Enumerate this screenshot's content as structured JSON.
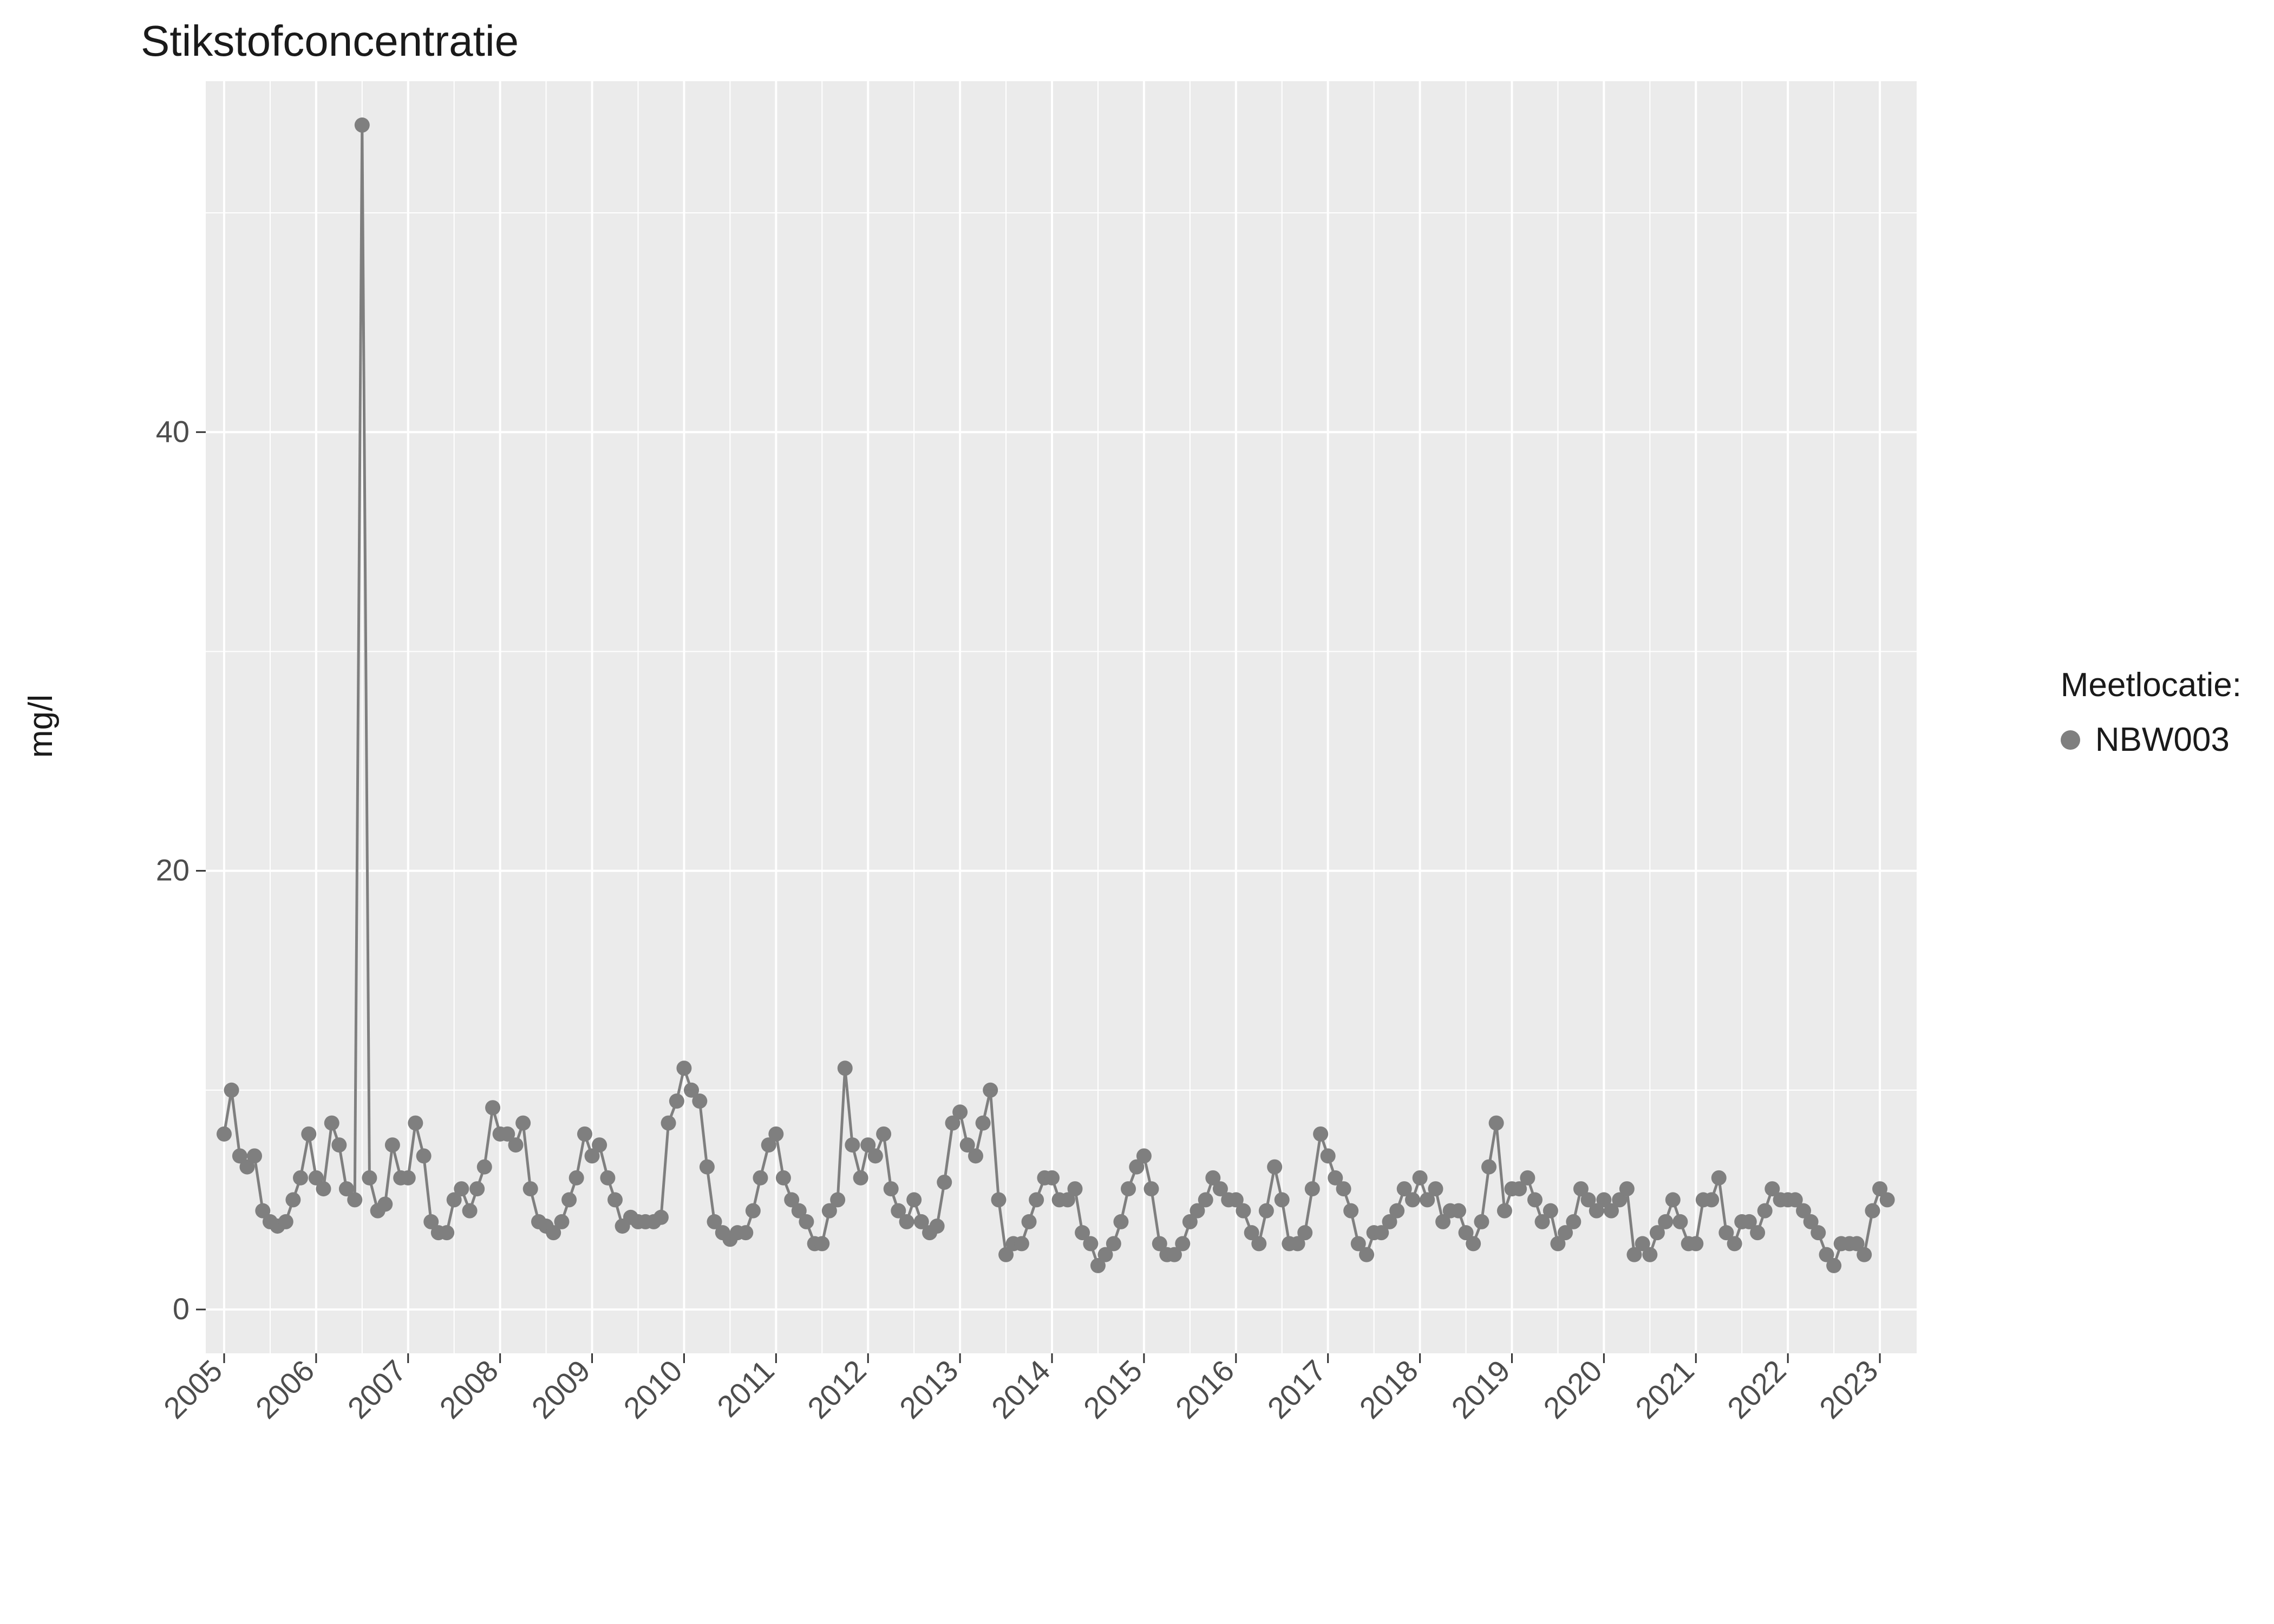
{
  "chart_data": {
    "type": "line",
    "title": "Stikstofconcentratie",
    "ylabel": "mg/l",
    "xlabel": "",
    "x_ticks": [
      "2005",
      "2006",
      "2007",
      "2008",
      "2009",
      "2010",
      "2011",
      "2012",
      "2013",
      "2014",
      "2015",
      "2016",
      "2017",
      "2018",
      "2019",
      "2020",
      "2021",
      "2022",
      "2023"
    ],
    "y_ticks": [
      0,
      20,
      40
    ],
    "ylim": [
      -2,
      56
    ],
    "xlim": [
      2004.8,
      2023.4
    ],
    "legend_title": "Meetlocatie:",
    "series": [
      {
        "name": "NBW003",
        "color": "#7f7f7f",
        "x": [
          2005.0,
          2005.08,
          2005.17,
          2005.25,
          2005.33,
          2005.42,
          2005.5,
          2005.58,
          2005.67,
          2005.75,
          2005.83,
          2005.92,
          2006.0,
          2006.08,
          2006.17,
          2006.25,
          2006.33,
          2006.42,
          2006.5,
          2006.58,
          2006.67,
          2006.75,
          2006.83,
          2006.92,
          2007.0,
          2007.08,
          2007.17,
          2007.25,
          2007.33,
          2007.42,
          2007.5,
          2007.58,
          2007.67,
          2007.75,
          2007.83,
          2007.92,
          2008.0,
          2008.08,
          2008.17,
          2008.25,
          2008.33,
          2008.42,
          2008.5,
          2008.58,
          2008.67,
          2008.75,
          2008.83,
          2008.92,
          2009.0,
          2009.08,
          2009.17,
          2009.25,
          2009.33,
          2009.42,
          2009.5,
          2009.58,
          2009.67,
          2009.75,
          2009.83,
          2009.92,
          2010.0,
          2010.08,
          2010.17,
          2010.25,
          2010.33,
          2010.42,
          2010.5,
          2010.58,
          2010.67,
          2010.75,
          2010.83,
          2010.92,
          2011.0,
          2011.08,
          2011.17,
          2011.25,
          2011.33,
          2011.42,
          2011.5,
          2011.58,
          2011.67,
          2011.75,
          2011.83,
          2011.92,
          2012.0,
          2012.08,
          2012.17,
          2012.25,
          2012.33,
          2012.42,
          2012.5,
          2012.58,
          2012.67,
          2012.75,
          2012.83,
          2012.92,
          2013.0,
          2013.08,
          2013.17,
          2013.25,
          2013.33,
          2013.42,
          2013.5,
          2013.58,
          2013.67,
          2013.75,
          2013.83,
          2013.92,
          2014.0,
          2014.08,
          2014.17,
          2014.25,
          2014.33,
          2014.42,
          2014.5,
          2014.58,
          2014.67,
          2014.75,
          2014.83,
          2014.92,
          2015.0,
          2015.08,
          2015.17,
          2015.25,
          2015.33,
          2015.42,
          2015.5,
          2015.58,
          2015.67,
          2015.75,
          2015.83,
          2015.92,
          2016.0,
          2016.08,
          2016.17,
          2016.25,
          2016.33,
          2016.42,
          2016.5,
          2016.58,
          2016.67,
          2016.75,
          2016.83,
          2016.92,
          2017.0,
          2017.08,
          2017.17,
          2017.25,
          2017.33,
          2017.42,
          2017.5,
          2017.58,
          2017.67,
          2017.75,
          2017.83,
          2017.92,
          2018.0,
          2018.08,
          2018.17,
          2018.25,
          2018.33,
          2018.42,
          2018.5,
          2018.58,
          2018.67,
          2018.75,
          2018.83,
          2018.92,
          2019.0,
          2019.08,
          2019.17,
          2019.25,
          2019.33,
          2019.42,
          2019.5,
          2019.58,
          2019.67,
          2019.75,
          2019.83,
          2019.92,
          2020.0,
          2020.08,
          2020.17,
          2020.25,
          2020.33,
          2020.42,
          2020.5,
          2020.58,
          2020.67,
          2020.75,
          2020.83,
          2020.92,
          2021.0,
          2021.08,
          2021.17,
          2021.25,
          2021.33,
          2021.42,
          2021.5,
          2021.58,
          2021.67,
          2021.75,
          2021.83,
          2021.92,
          2022.0,
          2022.08,
          2022.17,
          2022.25,
          2022.33,
          2022.42,
          2022.5,
          2022.58,
          2022.67,
          2022.75,
          2022.83,
          2022.92,
          2023.0,
          2023.08
        ],
        "values": [
          8.0,
          10.0,
          7.0,
          6.5,
          7.0,
          4.5,
          4.0,
          3.8,
          4.0,
          5.0,
          6.0,
          8.0,
          6.0,
          5.5,
          8.5,
          7.5,
          5.5,
          5.0,
          54.0,
          6.0,
          4.5,
          4.8,
          7.5,
          6.0,
          6.0,
          8.5,
          7.0,
          4.0,
          3.5,
          3.5,
          5.0,
          5.5,
          4.5,
          5.5,
          6.5,
          9.2,
          8.0,
          8.0,
          7.5,
          8.5,
          5.5,
          4.0,
          3.8,
          3.5,
          4.0,
          5.0,
          6.0,
          8.0,
          7.0,
          7.5,
          6.0,
          5.0,
          3.8,
          4.2,
          4.0,
          4.0,
          4.0,
          4.2,
          8.5,
          9.5,
          11.0,
          10.0,
          9.5,
          6.5,
          4.0,
          3.5,
          3.2,
          3.5,
          3.5,
          4.5,
          6.0,
          7.5,
          8.0,
          6.0,
          5.0,
          4.5,
          4.0,
          3.0,
          3.0,
          4.5,
          5.0,
          11.0,
          7.5,
          6.0,
          7.5,
          7.0,
          8.0,
          5.5,
          4.5,
          4.0,
          5.0,
          4.0,
          3.5,
          3.8,
          5.8,
          8.5,
          9.0,
          7.5,
          7.0,
          8.5,
          10.0,
          5.0,
          2.5,
          3.0,
          3.0,
          4.0,
          5.0,
          6.0,
          6.0,
          5.0,
          5.0,
          5.5,
          3.5,
          3.0,
          2.0,
          2.5,
          3.0,
          4.0,
          5.5,
          6.5,
          7.0,
          5.5,
          3.0,
          2.5,
          2.5,
          3.0,
          4.0,
          4.5,
          5.0,
          6.0,
          5.5,
          5.0,
          5.0,
          4.5,
          3.5,
          3.0,
          4.5,
          6.5,
          5.0,
          3.0,
          3.0,
          3.5,
          5.5,
          8.0,
          7.0,
          6.0,
          5.5,
          4.5,
          3.0,
          2.5,
          3.5,
          3.5,
          4.0,
          4.5,
          5.5,
          5.0,
          6.0,
          5.0,
          5.5,
          4.0,
          4.5,
          4.5,
          3.5,
          3.0,
          4.0,
          6.5,
          8.5,
          4.5,
          5.5,
          5.5,
          6.0,
          5.0,
          4.0,
          4.5,
          3.0,
          3.5,
          4.0,
          5.5,
          5.0,
          4.5,
          5.0,
          4.5,
          5.0,
          5.5,
          2.5,
          3.0,
          2.5,
          3.5,
          4.0,
          5.0,
          4.0,
          3.0,
          3.0,
          5.0,
          5.0,
          6.0,
          3.5,
          3.0,
          4.0,
          4.0,
          3.5,
          4.5,
          5.5,
          5.0,
          5.0,
          5.0,
          4.5,
          4.0,
          3.5,
          2.5,
          2.0,
          3.0,
          3.0,
          3.0,
          2.5,
          4.5,
          5.5,
          5.0
        ]
      }
    ]
  }
}
